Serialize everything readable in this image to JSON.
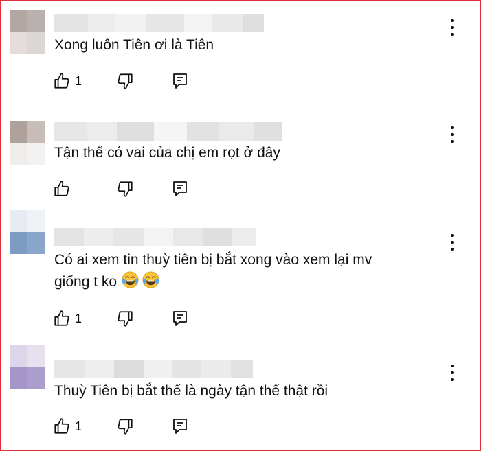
{
  "comments": [
    {
      "text": "Xong luôn Tiên ơi là Tiên",
      "like_count": "1",
      "avatar_colors": [
        "#b3a7a4",
        "#bab0ad",
        "#e3dcd9",
        "#dcd7d5"
      ],
      "name_blur_colors": [
        "#e4e4e4",
        "#ececec",
        "#f2f2f2",
        "#e6e6e6",
        "#f4f4f4",
        "#e9e9e9",
        "#dedede"
      ],
      "like_icon": "thumbs-up-icon",
      "dislike_icon": "thumbs-down-icon",
      "reply_icon": "reply-icon",
      "menu_icon": "more-vert-icon"
    },
    {
      "text": "Tận thế có vai của chị em rọt ở đây",
      "like_count": "",
      "avatar_colors": [
        "#aea19c",
        "#c7bcb7",
        "#f0eeed",
        "#f4f2f1"
      ],
      "name_blur_colors": [
        "#e7e7e7",
        "#ececec",
        "#dedede",
        "#f5f5f5",
        "#e2e2e2",
        "#eaeaea",
        "#e0e0e0"
      ],
      "like_icon": "thumbs-up-icon",
      "dislike_icon": "thumbs-down-icon",
      "reply_icon": "reply-icon",
      "menu_icon": "more-vert-icon"
    },
    {
      "text": "Có ai xem tin thuỳ tiên bị bắt xong vào xem lại mv\ngiống t ko",
      "emojis": [
        "😂",
        "😂"
      ],
      "like_count": "1",
      "avatar_colors": [
        "#e6ebf1",
        "#eef1f5",
        "#7d9cc4",
        "#8aa6cb"
      ],
      "name_blur_colors": [
        "#e3e3e3",
        "#ededed",
        "#e6e6e6",
        "#f3f3f3",
        "#e8e8e8",
        "#dfdfdf",
        "#ececec"
      ],
      "like_icon": "thumbs-up-icon",
      "dislike_icon": "thumbs-down-icon",
      "reply_icon": "reply-icon",
      "menu_icon": "more-vert-icon"
    },
    {
      "text": "Thuỳ Tiên bị bắt thế là ngày tận thế thật rồi",
      "like_count": "1",
      "avatar_colors": [
        "#ddd6ea",
        "#e6e0ef",
        "#a496c8",
        "#ab9ecd"
      ],
      "name_blur_colors": [
        "#e6e6e6",
        "#eeeeee",
        "#dcdcdc",
        "#f0f0f0",
        "#e4e4e4",
        "#ebebeb",
        "#e1e1e1"
      ],
      "like_icon": "thumbs-up-icon",
      "dislike_icon": "thumbs-down-icon",
      "reply_icon": "reply-icon",
      "menu_icon": "more-vert-icon"
    }
  ]
}
